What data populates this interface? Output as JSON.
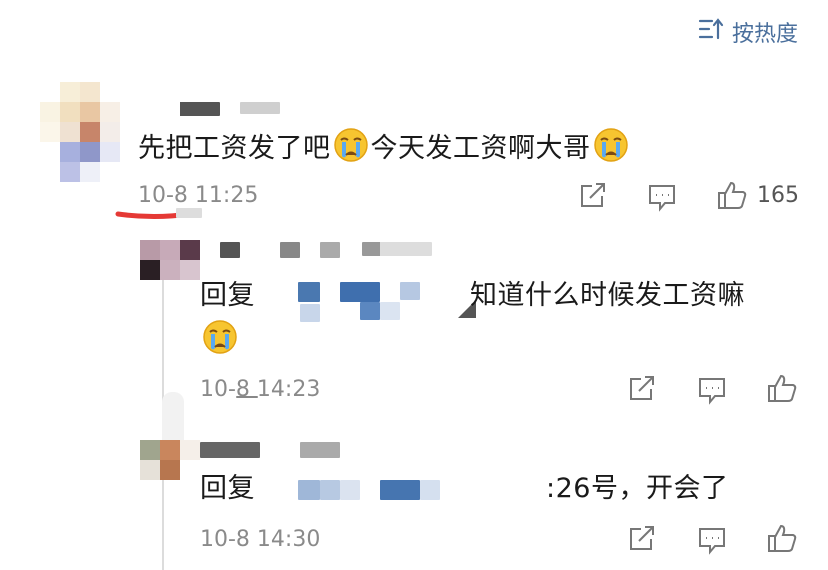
{
  "sort": {
    "label": "按热度",
    "icon": "sort-icon"
  },
  "comment": {
    "text_a": "先把工资发了吧",
    "text_b": "今天发工资啊大哥",
    "time": "10-8 11:25",
    "like_count": "165"
  },
  "reply1": {
    "prefix": "回复",
    "text": "知道什么时候发工资嘛",
    "time": "10-8 14:23"
  },
  "reply2": {
    "prefix": "回复",
    "text": ":26号，开会了",
    "time": "10-8 14:30"
  },
  "colors": {
    "accent": "#4a6f9c",
    "underline": "#e53935",
    "meta": "#8a8a8a"
  },
  "icons": [
    "sort-icon",
    "share-icon",
    "comment-icon",
    "like-icon",
    "crying-emoji-icon"
  ]
}
